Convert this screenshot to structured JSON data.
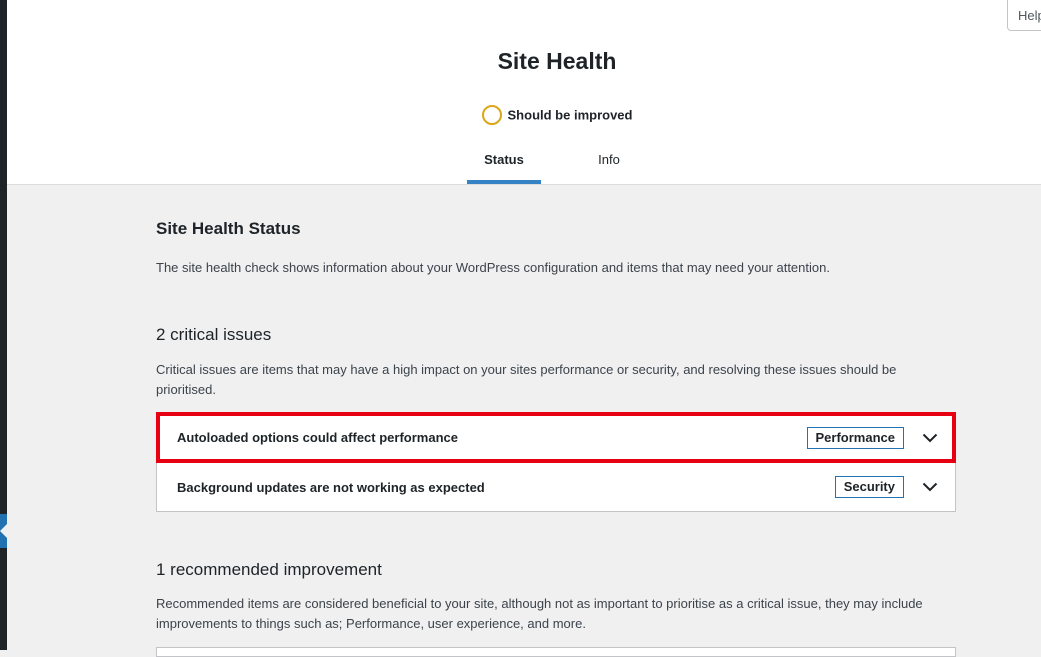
{
  "help_tab": {
    "label": "Help"
  },
  "header": {
    "title": "Site Health",
    "status_text": "Should be improved",
    "tabs": [
      {
        "label": "Status",
        "active": true
      },
      {
        "label": "Info",
        "active": false
      }
    ]
  },
  "main": {
    "heading": "Site Health Status",
    "intro": "The site health check shows information about your WordPress configuration and items that may need your attention.",
    "critical": {
      "title": "2 critical issues",
      "description": "Critical issues are items that may have a high impact on your sites performance or security, and resolving these issues should be prioritised.",
      "items": [
        {
          "title": "Autoloaded options could affect performance",
          "badge": "Performance"
        },
        {
          "title": "Background updates are not working as expected",
          "badge": "Security"
        }
      ]
    },
    "recommended": {
      "title": "1 recommended improvement",
      "description": "Recommended items are considered beneficial to your site, although not as important to prioritise as a critical issue, they may include improvements to things such as; Performance, user experience, and more."
    }
  },
  "colors": {
    "status_ring": "#dba617",
    "tab_underline": "#3582c4",
    "badge_border": "#2271b1",
    "highlight_outline": "#e60012"
  }
}
